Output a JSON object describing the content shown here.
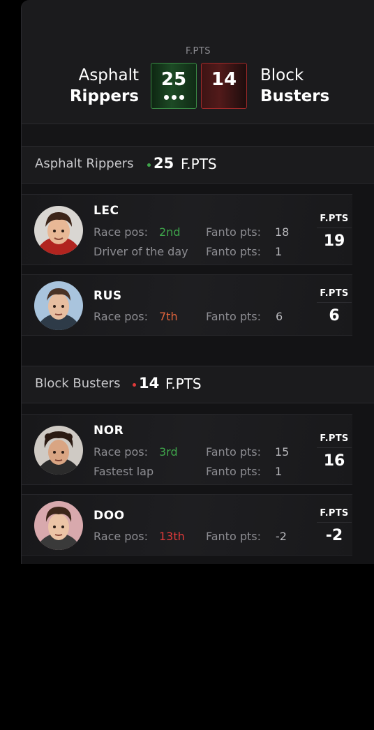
{
  "header": {
    "fpts_label": "F.PTS",
    "home": {
      "line1": "Asphalt",
      "line2": "Rippers",
      "score": "25"
    },
    "away": {
      "line1": "Block",
      "line2": "Busters",
      "score": "14"
    }
  },
  "colors": {
    "home_accent": "#3fa64b",
    "away_accent": "#e03a3a"
  },
  "sections": [
    {
      "team": "Asphalt Rippers",
      "points": "25",
      "unit": "F.PTS",
      "drivers": [
        {
          "code": "LEC",
          "row1": {
            "label": "Race pos:",
            "value": "2nd",
            "pts_label": "Fanto pts:",
            "pts_value": "18"
          },
          "row2": {
            "label": "Driver of the day",
            "pts_label": "Fanto pts:",
            "pts_value": "1"
          },
          "fpts_label": "F.PTS",
          "fpts": "19"
        },
        {
          "code": "RUS",
          "row1": {
            "label": "Race pos:",
            "value": "7th",
            "pts_label": "Fanto pts:",
            "pts_value": "6"
          },
          "fpts_label": "F.PTS",
          "fpts": "6"
        }
      ]
    },
    {
      "team": "Block Busters",
      "points": "14",
      "unit": "F.PTS",
      "drivers": [
        {
          "code": "NOR",
          "row1": {
            "label": "Race pos:",
            "value": "3rd",
            "pts_label": "Fanto pts:",
            "pts_value": "15"
          },
          "row2": {
            "label": "Fastest lap",
            "pts_label": "Fanto pts:",
            "pts_value": "1"
          },
          "fpts_label": "F.PTS",
          "fpts": "16"
        },
        {
          "code": "DOO",
          "row1": {
            "label": "Race pos:",
            "value": "13th",
            "pts_label": "Fanto pts:",
            "pts_value": "-2"
          },
          "fpts_label": "F.PTS",
          "fpts": "-2"
        }
      ]
    }
  ]
}
